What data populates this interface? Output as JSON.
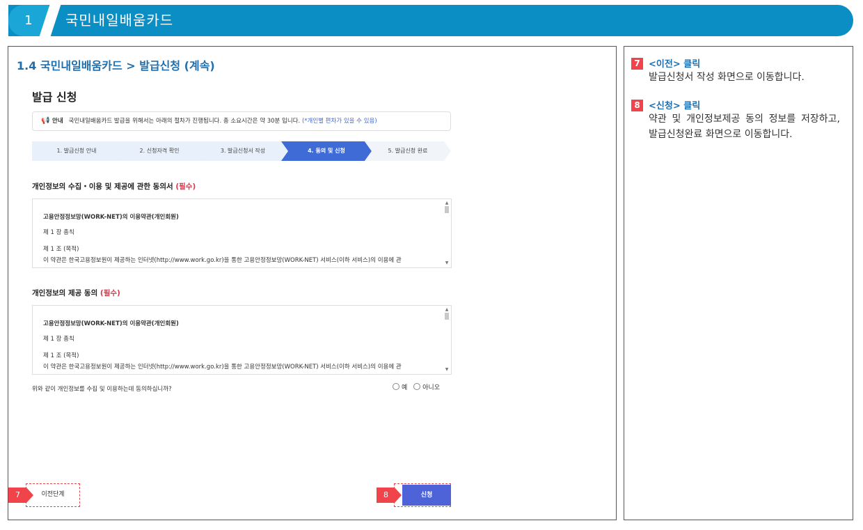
{
  "banner": {
    "number": "1",
    "title": "국민내일배움카드"
  },
  "section_title": "1.4 국민내일배움카드 > 발급신청 (계속)",
  "page_heading": "발급 신청",
  "notice": {
    "icon": "megaphone-icon",
    "label": "안내",
    "text": "국민내일배움카드 발급을 위해서는 아래의 절차가 진행됩니다. 총 소요시간은 약 30분 입니다.",
    "note": "(*개인별 편차가 있을 수 있음)"
  },
  "steps": [
    {
      "label": "1. 발급신청 안내",
      "active": false
    },
    {
      "label": "2. 신청자격 확인",
      "active": false
    },
    {
      "label": "3. 발급신청서 작성",
      "active": false
    },
    {
      "label": "4. 동의 및 신청",
      "active": true
    },
    {
      "label": "5. 발급신청 완료",
      "active": false
    }
  ],
  "consent1": {
    "heading": "개인정보의 수집・이용 및 제공에 관한 동의서",
    "required": "(필수)",
    "lines": [
      "고용안정정보망(WORK-NET)의 이용약관(개인회원)",
      "제 1 장 총칙",
      "제 1 조 (목적)",
      "이 약관은 한국고용정보원이 제공하는 인터넷(http://www.work.go.kr)을 통한 고용안정정보망(WORK-NET) 서비스(이하 서비스)의 이용에 관"
    ]
  },
  "consent2": {
    "heading": "개인정보의 제공 동의",
    "required": "(필수)",
    "lines": [
      "고용안정정보망(WORK-NET)의 이용약관(개인회원)",
      "제 1 장 총칙",
      "제 1 조 (목적)",
      "이 약관은 한국고용정보원이 제공하는 인터넷(http://www.work.go.kr)을 통한 고용안정정보망(WORK-NET) 서비스(이하 서비스)의 이용에 관"
    ]
  },
  "question": "위와 같이 개인정보를 수집 및 이용하는데 동의하십니까?",
  "radio_yes": "예",
  "radio_no": "아니오",
  "buttons": {
    "prev": "이전단계",
    "apply": "신청"
  },
  "markers": {
    "prev": "7",
    "apply": "8"
  },
  "instructions": [
    {
      "badge": "7",
      "title": "<이전> 클릭",
      "body": "발급신청서 작성 화면으로 이동합니다."
    },
    {
      "badge": "8",
      "title": "<신청> 클릭",
      "body": "약관 및 개인정보제공 동의 정보를 저장하고, 발급신청완료 화면으로 이동합니다."
    }
  ],
  "colors": {
    "banner": "#0b8ec4",
    "accent": "#1f6fae",
    "marker": "#f1444a",
    "active_step": "#3e6bd6",
    "required": "#d23a4c"
  }
}
